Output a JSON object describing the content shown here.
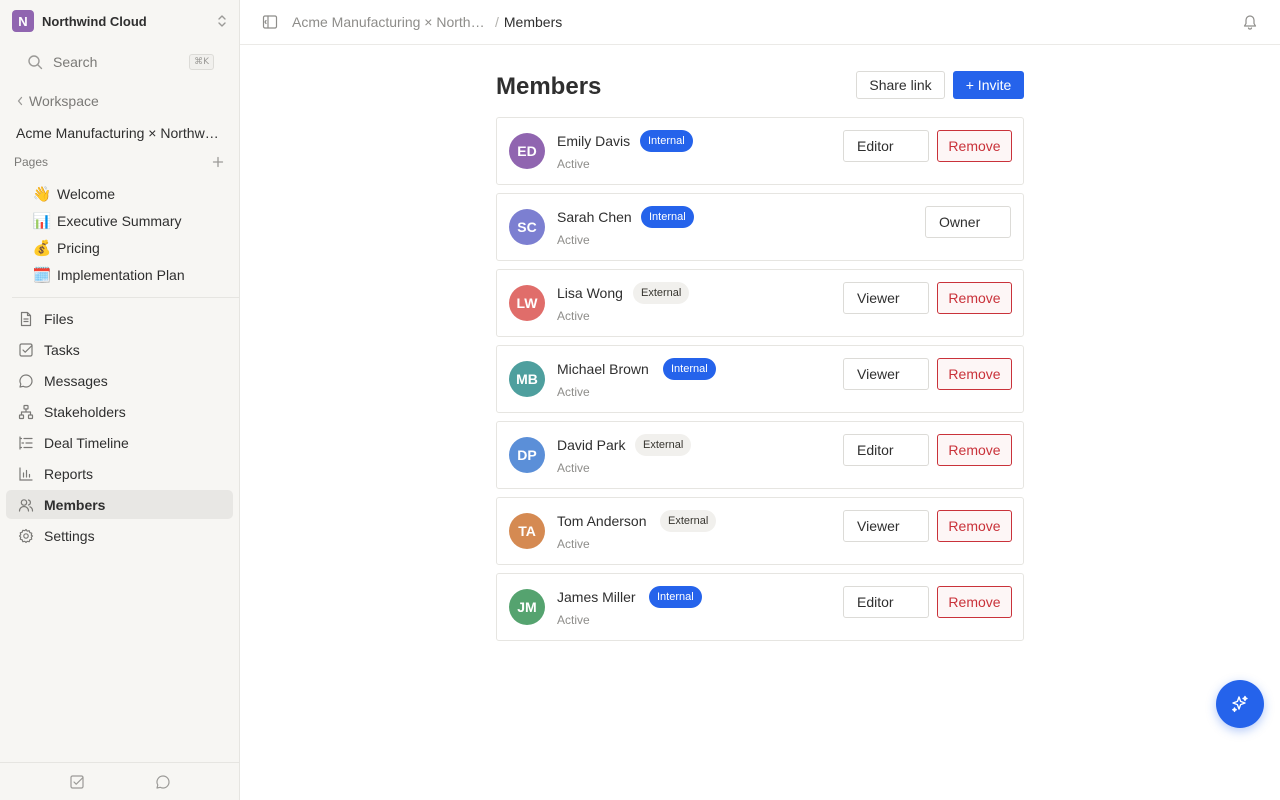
{
  "workspace": {
    "logo_letter": "N",
    "name": "Northwind Cloud"
  },
  "search": {
    "label": "Search",
    "shortcut": "⌘K"
  },
  "nav_back": {
    "label": "Workspace"
  },
  "project": {
    "name": "Acme Manufacturing × Northwind Cloud"
  },
  "pages": {
    "label": "Pages",
    "items": [
      {
        "emoji": "👋",
        "label": "Welcome"
      },
      {
        "emoji": "📊",
        "label": "Executive Summary"
      },
      {
        "emoji": "💰",
        "label": "Pricing"
      },
      {
        "emoji": "🗓️",
        "label": "Implementation Plan"
      }
    ]
  },
  "nav": {
    "items": [
      {
        "label": "Files",
        "icon": "file-icon"
      },
      {
        "label": "Tasks",
        "icon": "checkbox-icon"
      },
      {
        "label": "Messages",
        "icon": "message-icon"
      },
      {
        "label": "Stakeholders",
        "icon": "org-chart-icon"
      },
      {
        "label": "Deal Timeline",
        "icon": "timeline-icon"
      },
      {
        "label": "Reports",
        "icon": "bar-chart-icon"
      },
      {
        "label": "Members",
        "icon": "users-icon",
        "active": true
      },
      {
        "label": "Settings",
        "icon": "gear-icon"
      }
    ]
  },
  "breadcrumb": {
    "parent": "Acme Manufacturing × Northwind Cloud",
    "separator": "/",
    "current": "Members"
  },
  "main": {
    "title": "Members",
    "share_label": "Share link",
    "invite_label": "+ Invite"
  },
  "members": [
    {
      "initials": "ED",
      "name": "Emily Davis",
      "badge": "Internal",
      "status": "Active",
      "role": "Editor",
      "remove": "Remove",
      "avatar_color": "#9065b0"
    },
    {
      "initials": "SC",
      "name": "Sarah Chen",
      "badge": "Internal",
      "status": "Active",
      "role": "Owner",
      "remove": "",
      "avatar_color": "#7c7fd1"
    },
    {
      "initials": "LW",
      "name": "Lisa Wong",
      "badge": "External",
      "status": "Active",
      "role": "Viewer",
      "remove": "Remove",
      "avatar_color": "#e06d6a"
    },
    {
      "initials": "MB",
      "name": "Michael Brown",
      "badge": "Internal",
      "status": "Active",
      "role": "Viewer",
      "remove": "Remove",
      "avatar_color": "#4e9f9e"
    },
    {
      "initials": "DP",
      "name": "David Park",
      "badge": "External",
      "status": "Active",
      "role": "Editor",
      "remove": "Remove",
      "avatar_color": "#5b8fd8"
    },
    {
      "initials": "TA",
      "name": "Tom Anderson",
      "badge": "External",
      "status": "Active",
      "role": "Viewer",
      "remove": "Remove",
      "avatar_color": "#d58a52"
    },
    {
      "initials": "JM",
      "name": "James Miller",
      "badge": "Internal",
      "status": "Active",
      "role": "Editor",
      "remove": "Remove",
      "avatar_color": "#55a36f"
    }
  ],
  "colors": {
    "accent": "#2563eb",
    "danger": "#c9323a",
    "sidebar_bg": "#f7f6f3"
  }
}
